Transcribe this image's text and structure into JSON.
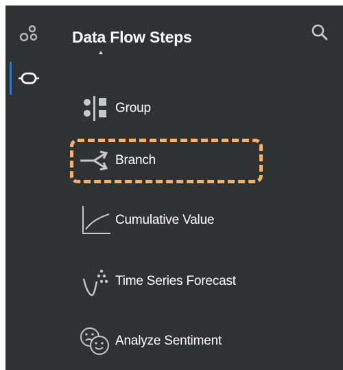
{
  "panel": {
    "title": "Data Flow Steps"
  },
  "rail": {
    "items": [
      {
        "icon": "share-network-icon",
        "active": false
      },
      {
        "icon": "data-flow-node-icon",
        "active": true
      }
    ],
    "active_color": "#2d78c8"
  },
  "search": {
    "icon": "search-icon"
  },
  "steps": [
    {
      "label": "Group",
      "icon": "group-icon"
    },
    {
      "label": "Branch",
      "icon": "branch-icon"
    },
    {
      "label": "Cumulative Value",
      "icon": "cumulative-value-icon"
    },
    {
      "label": "Time Series Forecast",
      "icon": "time-series-forecast-icon"
    },
    {
      "label": "Analyze Sentiment",
      "icon": "analyze-sentiment-icon"
    }
  ],
  "highlight": {
    "target": "Branch",
    "color": "#f6b26b"
  },
  "colors": {
    "background": "#2f3233",
    "text": "#ffffff",
    "icon": "#c8c8c8"
  }
}
